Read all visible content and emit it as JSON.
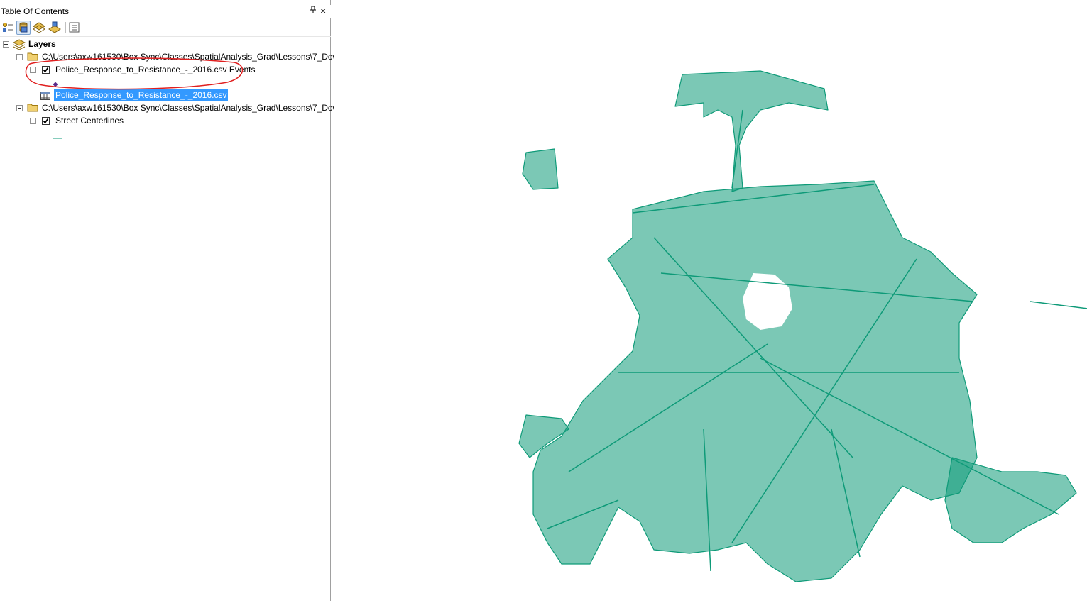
{
  "toc": {
    "title": "Table Of Contents",
    "pin_glyph": "↑",
    "close_glyph": "×",
    "toolbar": [
      {
        "name": "list-by-drawing-order-button",
        "icon": "list-drawing-order-icon"
      },
      {
        "name": "list-by-source-button",
        "icon": "list-source-icon"
      },
      {
        "name": "list-by-visibility-button",
        "icon": "list-visibility-icon"
      },
      {
        "name": "list-by-selection-button",
        "icon": "list-selection-icon"
      },
      {
        "name": "options-button",
        "icon": "options-icon"
      }
    ],
    "tree": {
      "root_label": "Layers",
      "folder1_path": "C:\\Users\\axw161530\\Box Sync\\Classes\\SpatialAnalysis_Grad\\Lessons\\7_Dowr",
      "events_layer_label": "Police_Response_to_Resistance_-_2016.csv Events",
      "table_label": "Police_Response_to_Resistance_-_2016.csv",
      "folder2_path": "C:\\Users\\axw161530\\Box Sync\\Classes\\SpatialAnalysis_Grad\\Lessons\\7_Dowr",
      "streets_layer_label": "Street Centerlines"
    }
  },
  "colors": {
    "street_line": "#0e9a78",
    "annotation_circle": "#e02020",
    "selection": "#3399ff",
    "point_symbol": "#5a2a8a"
  }
}
